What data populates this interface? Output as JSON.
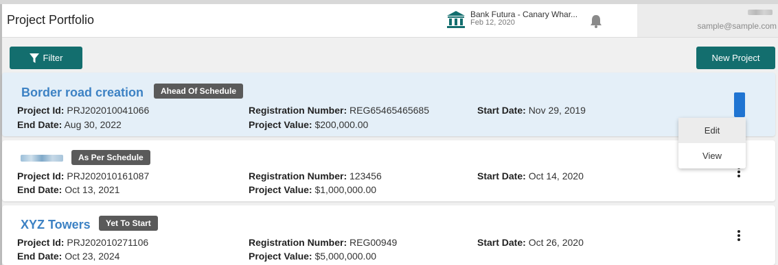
{
  "header": {
    "title": "Project Portfolio",
    "bank_name": "Bank Futura - Canary Whar...",
    "bank_date": "Feb 12, 2020",
    "user_email": "sample@sample.com"
  },
  "toolbar": {
    "filter_label": "Filter",
    "new_project_label": "New Project"
  },
  "labels": {
    "project_id": "Project Id:",
    "end_date": "End Date:",
    "registration_number": "Registration Number:",
    "project_value": "Project Value:",
    "start_date": "Start Date:"
  },
  "projects": [
    {
      "name": "Border road creation",
      "status": "Ahead Of Schedule",
      "project_id": "PRJ202010041066",
      "end_date": "Aug 30, 2022",
      "registration_number": "REG65465465685",
      "project_value": "$200,000.00",
      "start_date": "Nov 29, 2019"
    },
    {
      "name": "",
      "status": "As Per Schedule",
      "project_id": "PRJ202010161087",
      "end_date": "Oct 13, 2021",
      "registration_number": "123456",
      "project_value": "$1,000,000.00",
      "start_date": "Oct 14, 2020"
    },
    {
      "name": "XYZ Towers",
      "status": "Yet To Start",
      "project_id": "PRJ202010271106",
      "end_date": "Oct 23, 2024",
      "registration_number": "REG00949",
      "project_value": "$5,000,000.00",
      "start_date": "Oct 26, 2020"
    }
  ],
  "context_menu": {
    "items": [
      "Edit",
      "View"
    ]
  },
  "colors": {
    "accent": "#136e6e",
    "link": "#3d82c4",
    "badge": "#5a5a5a",
    "selected_card": "#e4eff8",
    "active_kebab": "#1f74d2"
  },
  "icons": {
    "bank": "bank-icon",
    "bell": "bell-icon",
    "filter": "filter-icon",
    "more": "more-vertical-icon"
  }
}
